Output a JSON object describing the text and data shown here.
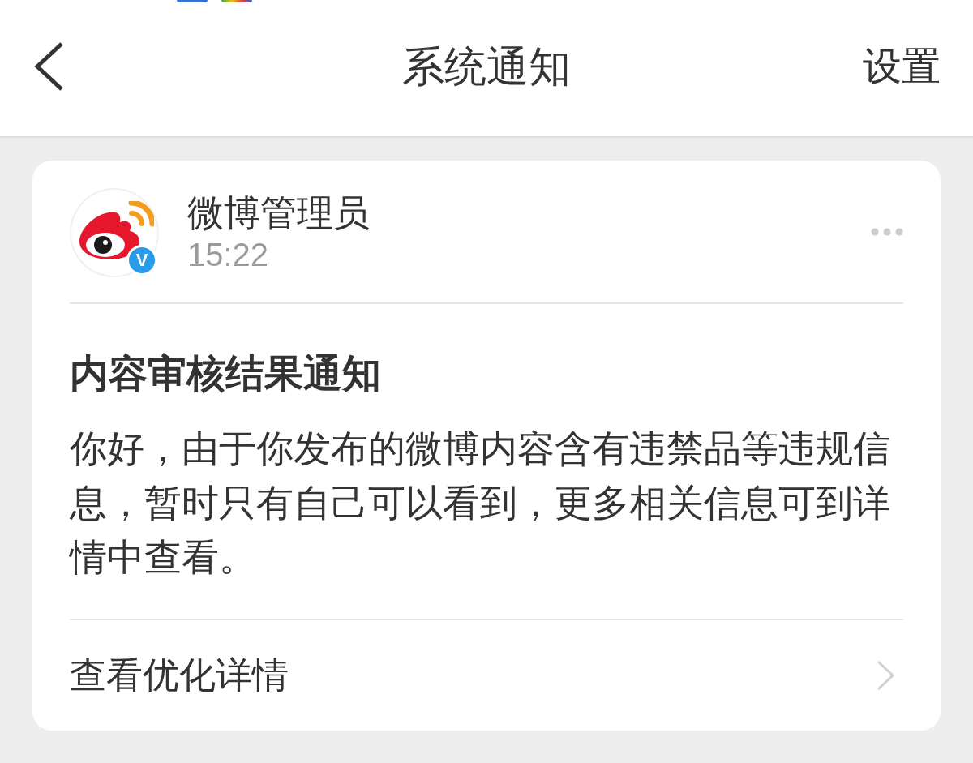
{
  "header": {
    "title": "系统通知",
    "action": "设置"
  },
  "notification": {
    "sender": {
      "name": "微博管理员",
      "time": "15:22",
      "verified": true,
      "badge": "V"
    },
    "title": "内容审核结果通知",
    "body": "你好，由于你发布的微博内容含有违禁品等违规信息，暂时只有自己可以看到，更多相关信息可到详情中查看。",
    "link": "查看优化详情"
  }
}
